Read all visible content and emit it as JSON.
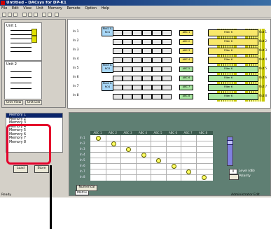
{
  "window": {
    "title": "Untitled - DACsys for DP-K1"
  },
  "menu": [
    "File",
    "Edit",
    "View",
    "Unit",
    "Memory",
    "Remote",
    "Option",
    "Help"
  ],
  "left_panel": {
    "unit1": "Unit 1",
    "unit2": "Unit 2",
    "tabs": [
      "Unit View",
      "Unit List"
    ]
  },
  "diagram": {
    "inputs": [
      "In 1",
      "In 2",
      "In 3",
      "In 4",
      "In 5",
      "In 6",
      "In 7",
      "In 8"
    ],
    "outputs": [
      "Out 1",
      "Out 2",
      "Out 3",
      "Out 4",
      "Out 5",
      "Out 6",
      "Out 7",
      "Out 8"
    ],
    "block_filter": "Filter",
    "big_blocks": [
      "Rkd1 X-NO1",
      "Rkd3 X-NO3",
      "Rkd4 X-NO4"
    ],
    "abc": [
      "ABC 1",
      "ABC 2",
      "ABC 3",
      "ABC 4",
      "ABC 5",
      "ABC 6",
      "ABC 7",
      "ABC 8"
    ],
    "filter": "Filter 6"
  },
  "memory": {
    "items": [
      "Memory 1",
      "Memory 2",
      "Memory 3",
      "Memory 4",
      "Memory 5",
      "Memory 6",
      "Memory 7",
      "Memory 8"
    ],
    "selected": 0,
    "load_label": "Load",
    "store_label": "Store"
  },
  "matrix": {
    "headers": [
      "ABC 1",
      "ABC 2",
      "ABC 3",
      "ABC 4",
      "ABC 5",
      "ABC 6",
      "ABC 7",
      "ABC 8"
    ],
    "rows": [
      "In 1",
      "In 2",
      "In 3",
      "In 4",
      "In 5",
      "In 6",
      "In 7",
      "In 8"
    ],
    "level_label": "Level (dB)",
    "polarity_label": "Polarity",
    "numerical_label": "Numerical",
    "tab_label": "Matrix",
    "fader_value": "0"
  },
  "statusbar": {
    "left": "Ready",
    "right": "Administrator Edit"
  }
}
